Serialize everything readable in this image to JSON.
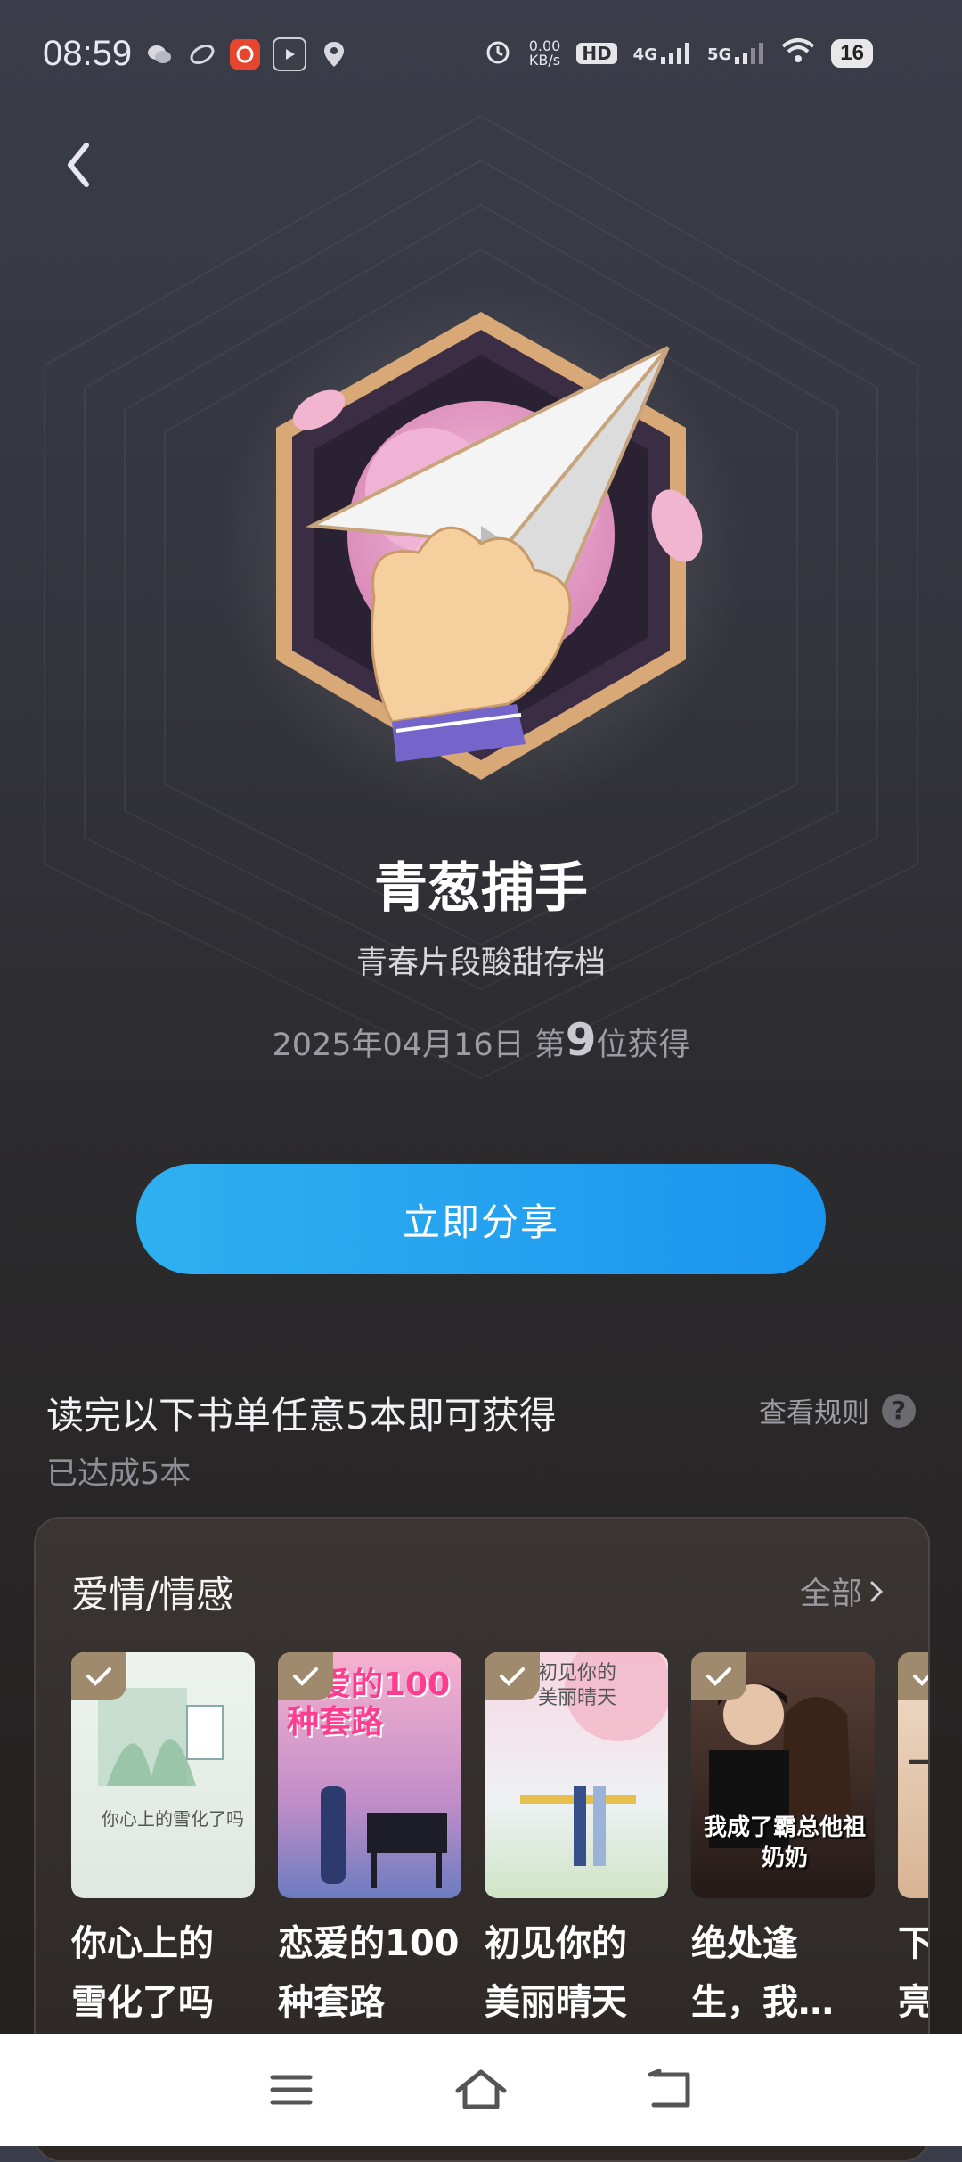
{
  "status_bar": {
    "time": "08:59",
    "net_speed_value": "0.00",
    "net_speed_unit": "KB/s",
    "hd_label": "HD",
    "signal_4g": "4G",
    "signal_5g": "5G",
    "battery": "16"
  },
  "badge": {
    "name": "青葱捕手",
    "description": "青春片段酸甜存档",
    "date_prefix": "2025年04月16日 第",
    "rank": "9",
    "date_suffix": "位获得"
  },
  "share_button": {
    "label": "立即分享"
  },
  "task": {
    "title": "读完以下书单任意5本即可获得",
    "progress": "已达成5本",
    "rules_label": "查看规则",
    "rules_icon": "?"
  },
  "booklist": {
    "category": "爱情/情感",
    "all_label": "全部",
    "books": [
      {
        "line1": "你心上的",
        "line2": "雪化了吗",
        "cover_title": "你心上的雪化了吗",
        "accent": "#e9efe9"
      },
      {
        "line1": "恋爱的100",
        "line2": "种套路",
        "cover_title": "恋爱的100种套路",
        "accent": "#f4a6c8"
      },
      {
        "line1": "初见你的",
        "line2": "美丽晴天",
        "cover_title": "初见你的美丽晴天",
        "accent": "#f6d6df"
      },
      {
        "line1": "绝处逢",
        "line2": "生，我…",
        "cover_title": "我成了霸总他祖奶奶",
        "accent": "#3a2a26"
      },
      {
        "line1": "下",
        "line2": "亮",
        "cover_title": "下",
        "accent": "#e8d2bf"
      }
    ]
  },
  "colors": {
    "share_button": "#1a95ee",
    "badge_frame": "#d9a877",
    "check_bg": "#a08a6e"
  }
}
